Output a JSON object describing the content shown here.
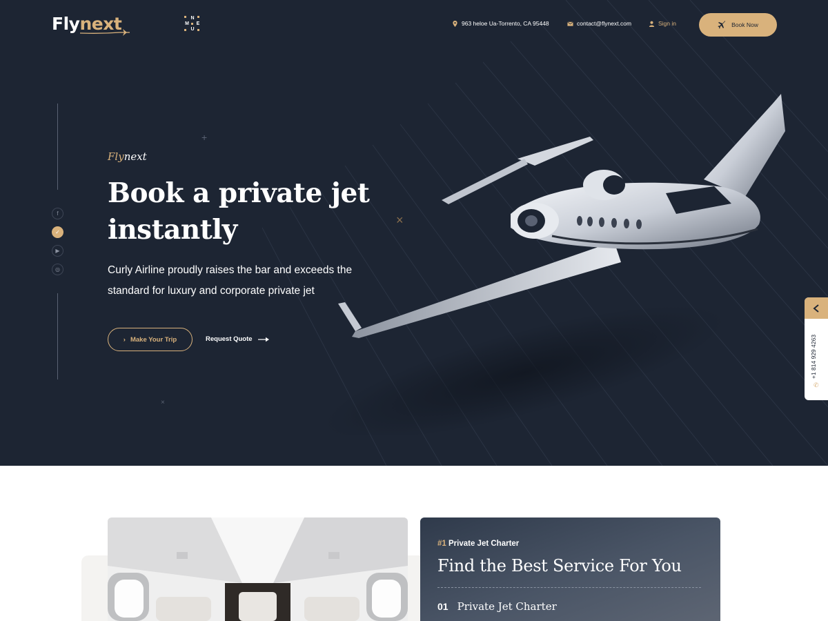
{
  "header": {
    "logo_part1": "Fly",
    "logo_part2": "next",
    "menu_letters": [
      "N",
      "M",
      "E",
      "U"
    ],
    "address": "963 heloe Ua-Torrento, CA 95448",
    "email": "contact@flynext.com",
    "signin": "Sign in",
    "book_now": "Book Now"
  },
  "hero": {
    "brand_part1": "Fly",
    "brand_part2": "next",
    "title_line1": "Book a private jet",
    "title_line2": "instantly",
    "description": "Curly Airline proudly raises the bar and exceeds the standard for luxury and corporate private jet",
    "primary_button": "Make Your Trip",
    "secondary_link": "Request Quote"
  },
  "social": [
    {
      "icon": "facebook-icon",
      "glyph": "f"
    },
    {
      "icon": "twitter-icon",
      "glyph": "✓"
    },
    {
      "icon": "youtube-icon",
      "glyph": "▶"
    },
    {
      "icon": "instagram-icon",
      "glyph": "◎"
    }
  ],
  "side_tab": {
    "phone": "+1 814 929 4263"
  },
  "service_card": {
    "tag_number": "#1",
    "tag_label": "Private Jet Charter",
    "title": "Find the Best Service For You",
    "items": [
      {
        "number": "01",
        "label": "Private Jet Charter"
      }
    ]
  },
  "colors": {
    "hero_bg": "#1d2533",
    "accent": "#d9b27c",
    "white": "#ffffff"
  }
}
